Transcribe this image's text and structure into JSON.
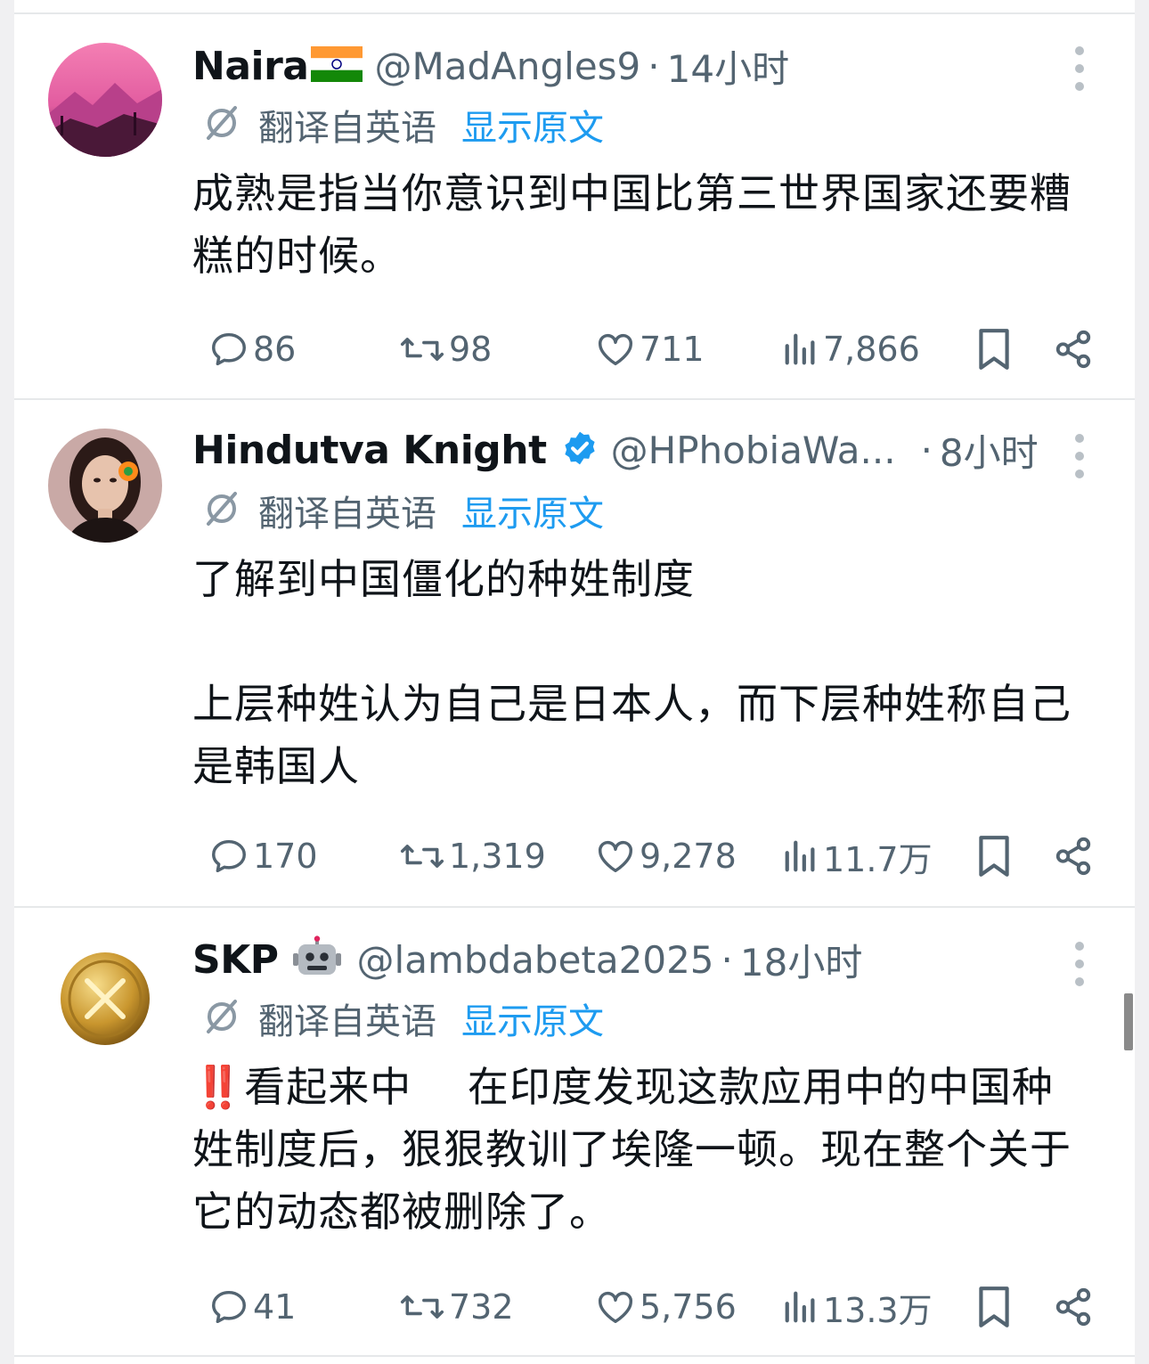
{
  "tweets": [
    {
      "name": "Naira",
      "flag": "🇮🇳",
      "handle": "@MadAngles9",
      "dot": "·",
      "time": "14小时",
      "translate_label": "翻译自英语",
      "show_original": "显示原文",
      "text": "成熟是指当你意识到中国比第三世界国家还要糟\n糕的时候。",
      "replies": "86",
      "retweets": "98",
      "likes": "711",
      "views": "7,866"
    },
    {
      "name": "Hindutva Knight",
      "handle": "@HPhobiaWa...",
      "dot": "·",
      "time": "8小时",
      "translate_label": "翻译自英语",
      "show_original": "显示原文",
      "text": "了解到中国僵化的种姓制度\n\n上层种姓认为自己是日本人，而下层种姓称自己\n是韩国人",
      "replies": "170",
      "retweets": "1,319",
      "likes": "9,278",
      "views": "11.7万"
    },
    {
      "name": "SKP",
      "emoji": "🤖",
      "handle": "@lambdabeta2025",
      "dot": "·",
      "time": "18小时",
      "translate_label": "翻译自英语",
      "show_original": "显示原文",
      "bangs": "‼️",
      "text": "看起来中　 在印度发现这款应用中的中国种\n姓制度后，狠狠教训了埃隆一顿。现在整个关于\n它的动态都被删除了。",
      "replies": "41",
      "retweets": "732",
      "likes": "5,756",
      "views": "13.3万"
    }
  ],
  "colors": {
    "link": "#1d9bf0",
    "secondary": "#536471",
    "verified": "#1d9bf0"
  }
}
